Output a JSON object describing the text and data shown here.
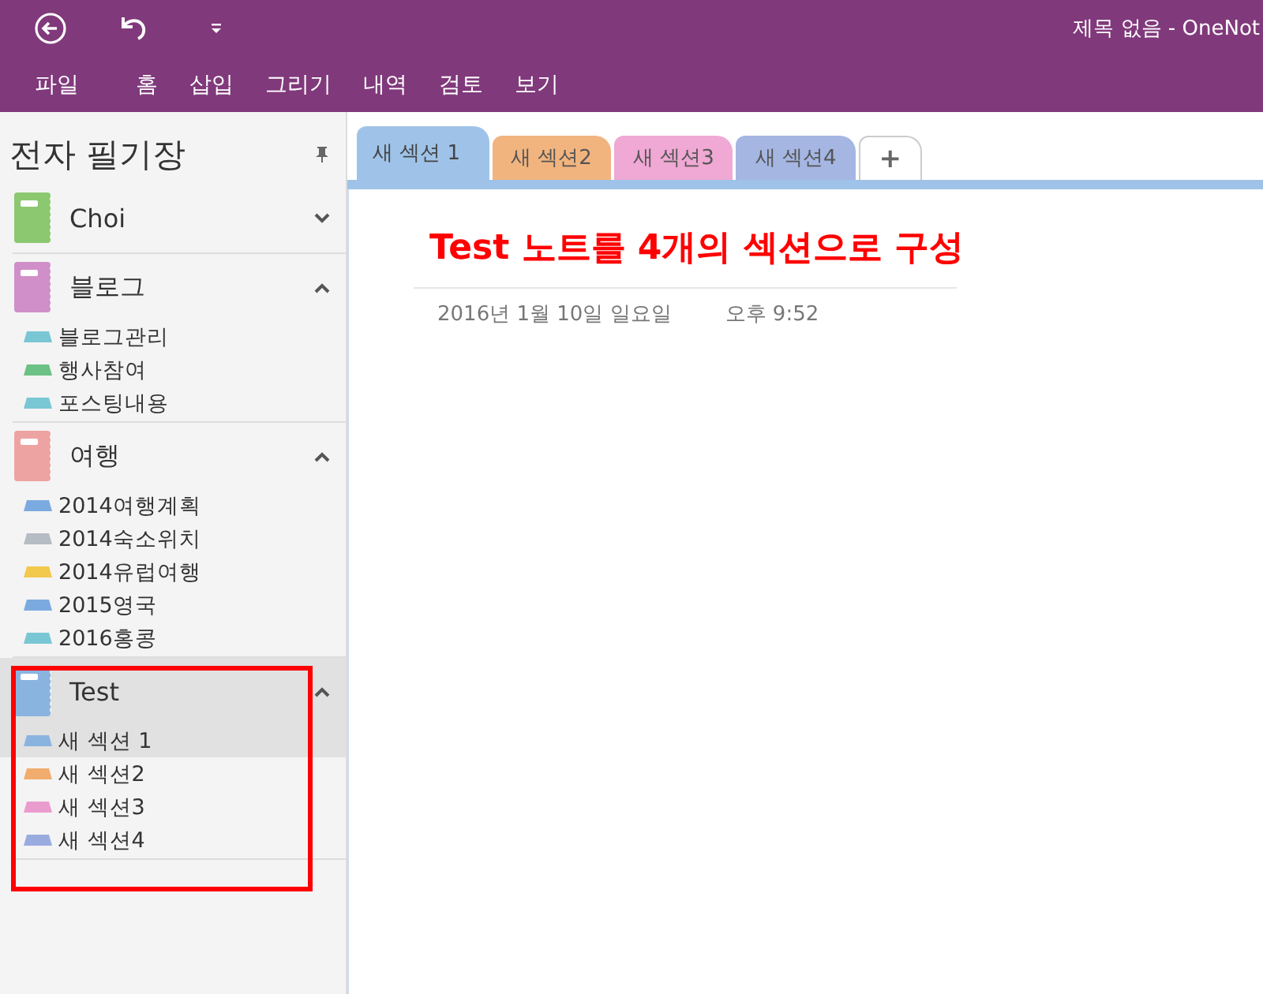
{
  "window": {
    "title": "제목 없음 - OneNot"
  },
  "ribbon_tabs": [
    {
      "label": "파일",
      "kind": "file"
    },
    {
      "label": "홈",
      "kind": "tab"
    },
    {
      "label": "삽입",
      "kind": "tab"
    },
    {
      "label": "그리기",
      "kind": "tab"
    },
    {
      "label": "내역",
      "kind": "tab"
    },
    {
      "label": "검토",
      "kind": "tab"
    },
    {
      "label": "보기",
      "kind": "tab"
    }
  ],
  "sidebar": {
    "title": "전자 필기장",
    "notebooks": [
      {
        "name": "Choi",
        "color": "#8cc870",
        "expanded": false,
        "selected": false
      },
      {
        "name": "블로그",
        "color": "#d08fc9",
        "expanded": true,
        "selected": false,
        "sections": [
          {
            "name": "블로그관리",
            "color": "#79c7d4",
            "selected": false
          },
          {
            "name": "행사참여",
            "color": "#6cc184",
            "selected": false
          },
          {
            "name": "포스팅내용",
            "color": "#79c7d4",
            "selected": false
          }
        ]
      },
      {
        "name": "여행",
        "color": "#eea3a3",
        "expanded": true,
        "selected": false,
        "sections": [
          {
            "name": "2014여행계획",
            "color": "#7aaae0",
            "selected": false
          },
          {
            "name": "2014숙소위치",
            "color": "#b6bcc4",
            "selected": false
          },
          {
            "name": "2014유럽여행",
            "color": "#f2c94c",
            "selected": false
          },
          {
            "name": "2015영국",
            "color": "#7aaae0",
            "selected": false
          },
          {
            "name": "2016홍콩",
            "color": "#79c7d4",
            "selected": false
          }
        ]
      },
      {
        "name": "Test",
        "color": "#8ab4e0",
        "expanded": true,
        "selected": true,
        "sections": [
          {
            "name": "새 섹션 1",
            "color": "#8ab4e0",
            "selected": true
          },
          {
            "name": "새 섹션2",
            "color": "#f0ad6e",
            "selected": false
          },
          {
            "name": "새 섹션3",
            "color": "#eb9ccf",
            "selected": false
          },
          {
            "name": "새 섹션4",
            "color": "#9aabe0",
            "selected": false
          }
        ]
      }
    ]
  },
  "section_tabs": [
    {
      "label": "새 섹션 1",
      "color": "#9fc3e8",
      "selected": true
    },
    {
      "label": "새 섹션2",
      "color": "#f2b47f",
      "selected": false
    },
    {
      "label": "새 섹션3",
      "color": "#f0a8d4",
      "selected": false
    },
    {
      "label": "새 섹션4",
      "color": "#a5b6e3",
      "selected": false
    }
  ],
  "add_tab": "+",
  "page": {
    "title": "Test 노트를 4개의 섹션으로 구성",
    "date": "2016년 1월 10일 일요일",
    "time": "오후 9:52"
  }
}
